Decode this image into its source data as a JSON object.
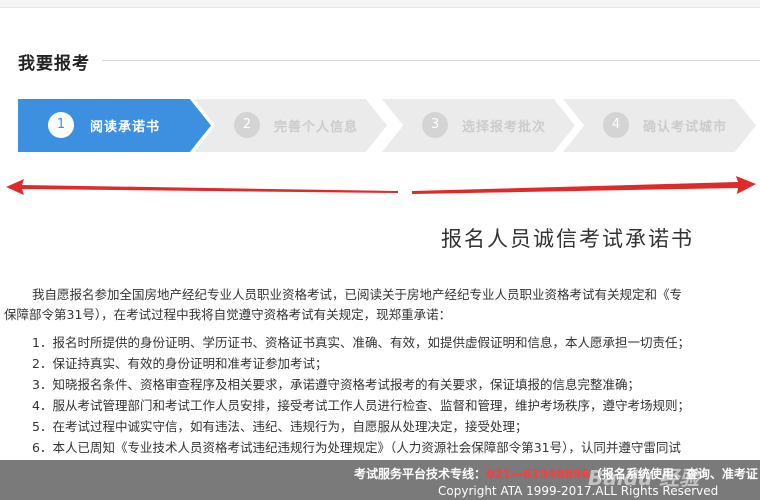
{
  "header": {
    "title": "我要报考"
  },
  "steps": [
    {
      "num": "1",
      "label": "阅读承诺书"
    },
    {
      "num": "2",
      "label": "完善个人信息"
    },
    {
      "num": "3",
      "label": "选择报考批次"
    },
    {
      "num": "4",
      "label": "确认考试城市"
    }
  ],
  "document": {
    "title": "报名人员诚信考试承诺书",
    "intro_line1": "我自愿报名参加全国房地产经纪专业人员职业资格考试，已阅读关于房地产经纪专业人员职业资格考试有关规定和《专",
    "intro_line2": "保障部令第31号），在考试过程中我将自觉遵守资格考试有关规定，现郑重承诺：",
    "items": [
      "1．报名时所提供的身份证明、学历证书、资格证书真实、准确、有效，如提供虚假证明和信息，本人愿承担一切责任；",
      "2．保证持真实、有效的身份证明和准考证参加考试；",
      "3．知晓报名条件、资格审查程序及相关要求，承诺遵守资格考试报考的有关要求，保证填报的信息完整准确；",
      "4．服从考试管理部门和考试工作人员安排，接受考试工作人员进行检查、监督和管理，维护考场秩序，遵守考场规则；",
      "5．在考试过程中诚实守信，如有违法、违纪、违规行为，自愿服从处理决定，接受处理；",
      "6．本人已周知《专业技术人员资格考试违纪违规行为处理规定》（人力资源社会保障部令第31号），认同并遵守雷同试"
    ]
  },
  "footer": {
    "hotline_label": "考试服务平台技术专线：",
    "hotline_number": "021—61948896",
    "hotline_suffix": "（报名系统使用、查询、准考证",
    "copyright": "Copyright ATA 1999-2017.ALL Rights Reserved",
    "watermark": "Baidu 经验"
  },
  "colors": {
    "accent": "#3d8fe0",
    "arrow": "#e02a2a",
    "footer_bg": "#7a7a7a",
    "phone": "#ff3b3b"
  }
}
